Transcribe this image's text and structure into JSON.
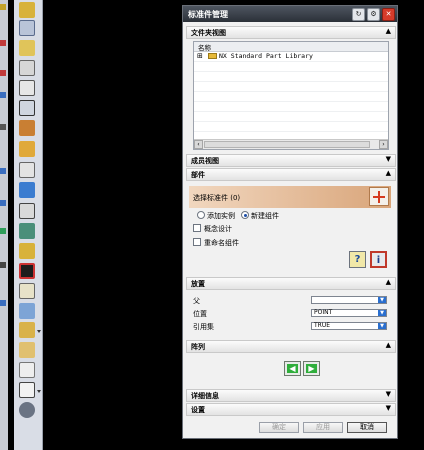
{
  "dialog": {
    "title": "标准件管理",
    "title_buttons": [
      "↻",
      "⚙",
      "✕"
    ]
  },
  "sections": {
    "folder_view": "文件夹视图",
    "member_view": "成员视图",
    "part": "部件",
    "placement": "放置",
    "interval": "阵列",
    "details": "详细信息",
    "settings": "设置"
  },
  "tree": {
    "column_header": "名称",
    "rows": [
      {
        "expander": "⊞",
        "label": "NX Standard Part Library"
      }
    ]
  },
  "part": {
    "select_label": "选择标准件 (0)",
    "radio_add": "添加实例",
    "radio_new": "新建组件",
    "radio_selected": "radio_new",
    "check_concept": "概念设计",
    "check_reuse": "重命名组件",
    "help_button": "?",
    "info_button": "i"
  },
  "placement": {
    "parent_label": "父",
    "parent_value": "",
    "position_label": "位置",
    "position_value": "POINT",
    "ref_label": "引用集",
    "ref_value": "TRUE"
  },
  "footer": {
    "ok": "确定",
    "apply": "应用",
    "cancel": "取消"
  },
  "colors": {
    "accent_orange": "#d9a57a",
    "green_button": "#2fae3b",
    "titlebar": "#2b3038",
    "close_red": "#d63b2a"
  }
}
